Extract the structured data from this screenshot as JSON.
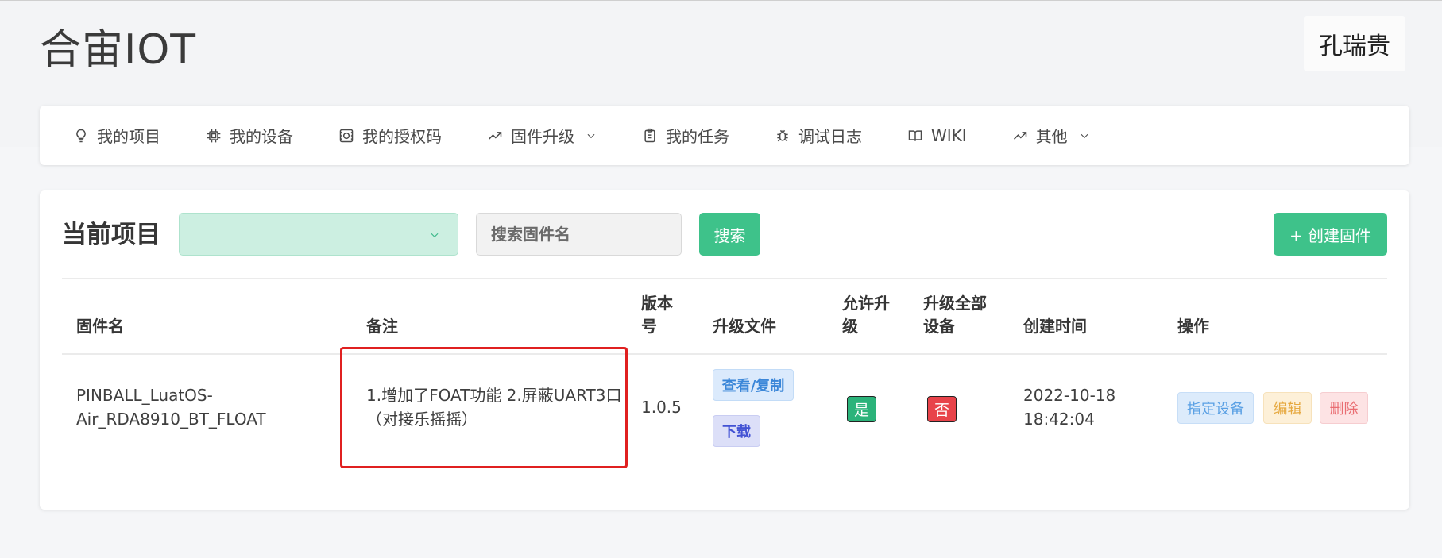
{
  "app": {
    "brand": "合宙IOT",
    "user": "孔瑞贵"
  },
  "nav": [
    {
      "label": "我的项目",
      "icon": "bulb-icon"
    },
    {
      "label": "我的设备",
      "icon": "chip-icon"
    },
    {
      "label": "我的授权码",
      "icon": "license-icon"
    },
    {
      "label": "固件升级",
      "icon": "trend-icon",
      "dropdown": true
    },
    {
      "label": "我的任务",
      "icon": "clipboard-icon"
    },
    {
      "label": "调试日志",
      "icon": "bug-icon"
    },
    {
      "label": "WIKI",
      "icon": "book-icon"
    },
    {
      "label": "其他",
      "icon": "trend-icon",
      "dropdown": true
    }
  ],
  "toolbar": {
    "title": "当前项目",
    "project_value": "",
    "search_placeholder": "搜索固件名",
    "search_label": "搜索",
    "create_label": "+ 创建固件"
  },
  "table": {
    "headers": {
      "name": "固件名",
      "remark": "备注",
      "version_l1": "版本",
      "version_l2": "号",
      "file": "升级文件",
      "allow_l1": "允许升",
      "allow_l2": "级",
      "all_l1": "升级全部",
      "all_l2": "设备",
      "created": "创建时间",
      "actions": "操作"
    },
    "rows": [
      {
        "name_l1": "PINBALL_LuatOS-",
        "name_l2": "Air_RDA8910_BT_FLOAT",
        "remark_l1": "1.增加了FOAT功能 2.屏蔽UART3口",
        "remark_l2": "（对接乐摇摇）",
        "version": "1.0.5",
        "view_label": "查看/复制",
        "download_label": "下载",
        "allow": "是",
        "all_devices": "否",
        "created_l1": "2022-10-18",
        "created_l2": "18:42:04",
        "assign_label": "指定设备",
        "edit_label": "编辑",
        "delete_label": "删除"
      }
    ]
  }
}
